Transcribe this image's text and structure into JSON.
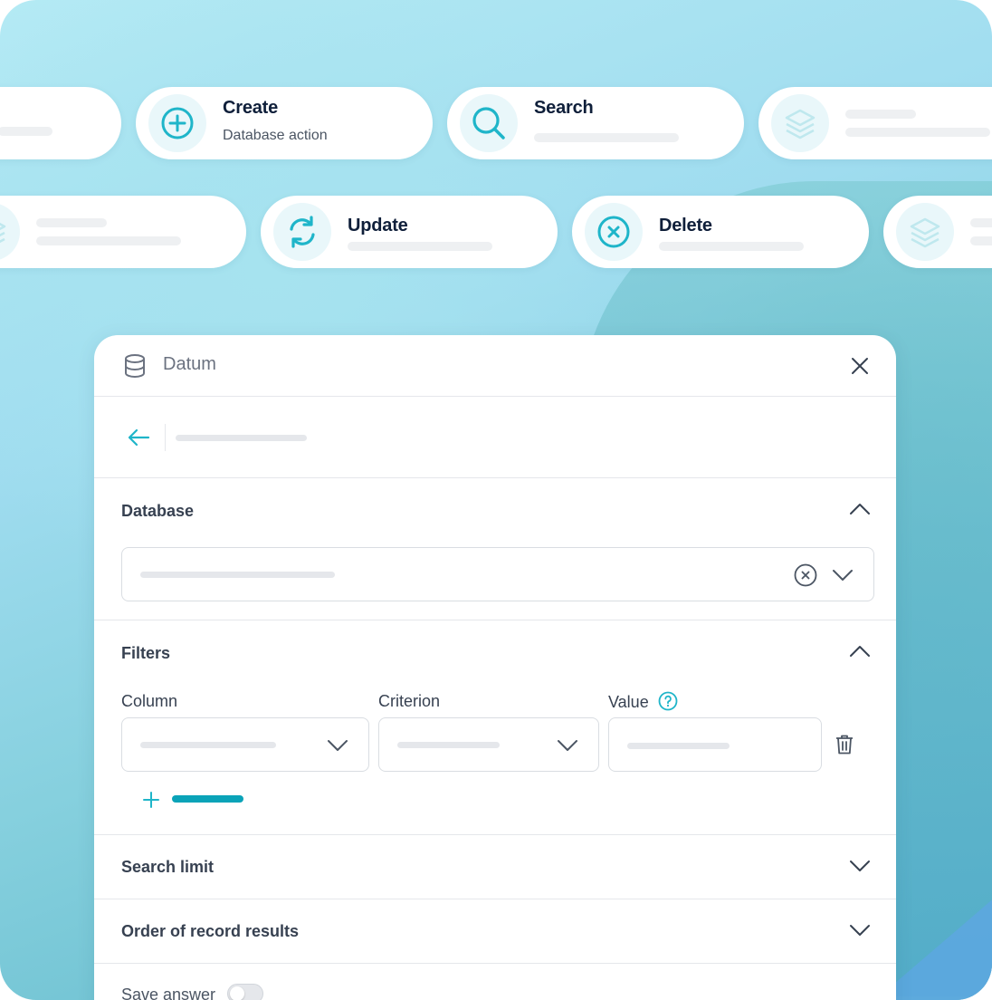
{
  "colors": {
    "accent": "#1fb5c9",
    "accent_dark": "#0aa3b8",
    "text": "#0f1f3a",
    "muted": "#6b7280"
  },
  "actions": {
    "create": {
      "title": "Create",
      "subtitle": "Database action",
      "icon": "plus-circle-icon"
    },
    "search": {
      "title": "Search",
      "icon": "search-icon"
    },
    "update": {
      "title": "Update",
      "icon": "refresh-icon"
    },
    "delete": {
      "title": "Delete",
      "icon": "x-circle-icon"
    },
    "placeholder_icon": "layers-icon"
  },
  "panel": {
    "title": "Datum",
    "sections": {
      "database": {
        "title": "Database"
      },
      "filters": {
        "title": "Filters",
        "columns": {
          "column": "Column",
          "criterion": "Criterion",
          "value": "Value"
        }
      },
      "search_limit": {
        "title": "Search limit"
      },
      "order": {
        "title": "Order of record results"
      },
      "save_answer": {
        "label": "Save answer"
      }
    }
  }
}
